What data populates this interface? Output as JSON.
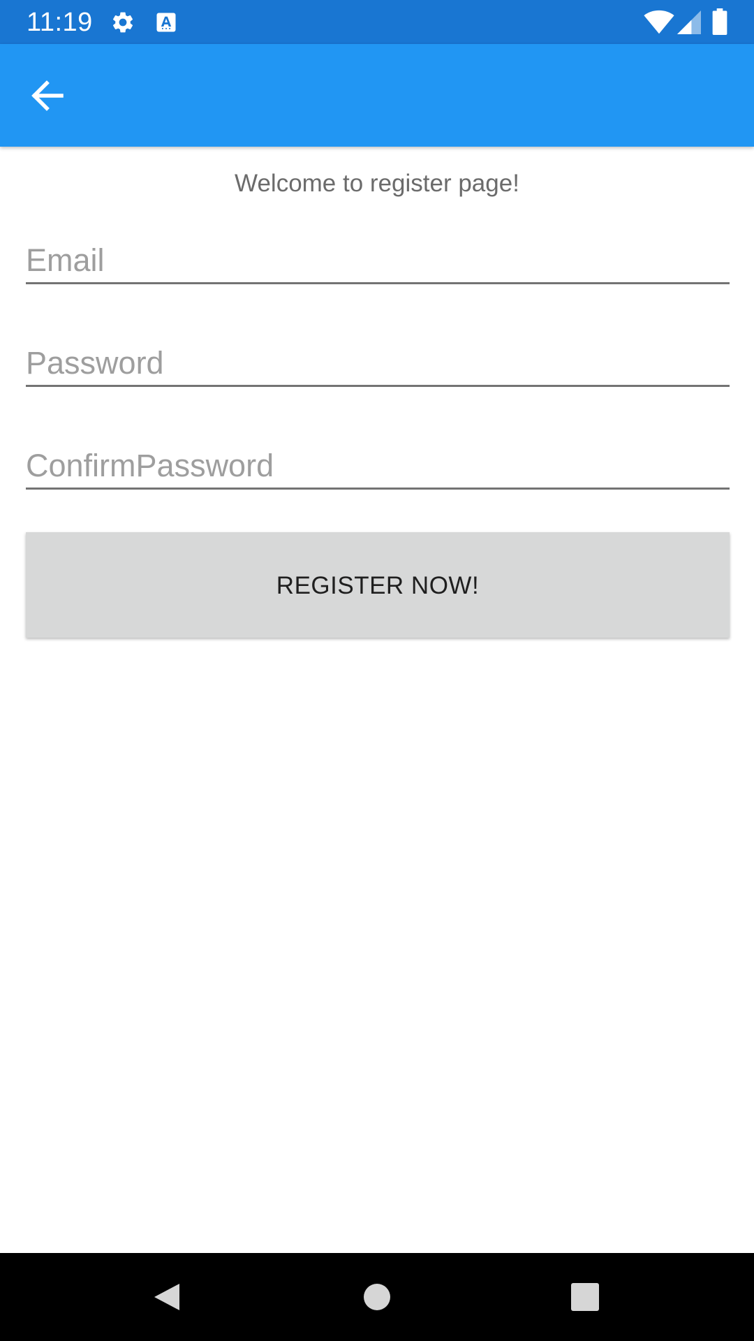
{
  "status_bar": {
    "time": "11:19",
    "icons": [
      "gear-icon",
      "a11y-keyboard-icon",
      "wifi-icon",
      "signal-icon",
      "battery-icon"
    ],
    "color": "#1976D2"
  },
  "app_bar": {
    "color": "#2196F3",
    "back_icon": "arrow-back-icon"
  },
  "main": {
    "welcome_text": "Welcome to register page!",
    "email": {
      "placeholder": "Email",
      "value": ""
    },
    "password": {
      "placeholder": "Password",
      "value": ""
    },
    "confirm_password": {
      "placeholder": "ConfirmPassword",
      "value": ""
    },
    "register_button_label": "REGISTER NOW!"
  },
  "nav_bar": {
    "buttons": [
      "back-triangle-icon",
      "home-circle-icon",
      "recents-square-icon"
    ]
  }
}
